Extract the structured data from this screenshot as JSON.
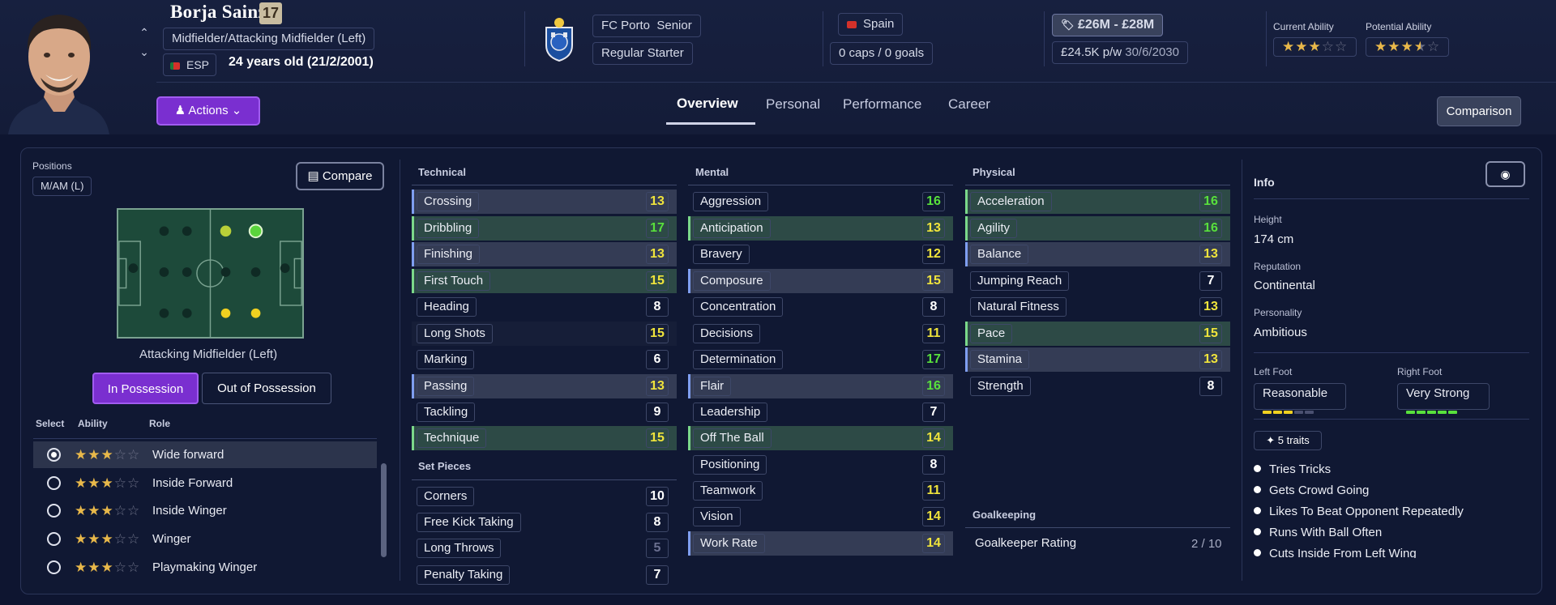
{
  "player": {
    "name": "Borja Sainz",
    "number": "17",
    "position": "Midfielder/Attacking Midfielder (Left)",
    "nationality_code": "ESP",
    "age_line": "24 years old (21/2/2001)"
  },
  "club": {
    "name": "FC Porto",
    "squad": "Senior",
    "status": "Regular Starter"
  },
  "nation": {
    "country": "Spain",
    "caps": "0 caps / 0 goals"
  },
  "contract": {
    "value": "£26M - £28M",
    "wage": "£24.5K p/w",
    "expiry": "30/6/2030"
  },
  "ability": {
    "current_label": "Current Ability",
    "potential_label": "Potential Ability",
    "current_stars": 3,
    "potential_stars": 3.5
  },
  "actions_label": "Actions",
  "tabs": [
    "Overview",
    "Personal",
    "Performance",
    "Career"
  ],
  "comparison_label": "Comparison",
  "positions": {
    "label": "Positions",
    "short": "M/AM (L)",
    "compare_label": "Compare",
    "current_position": "Attacking Midfielder (Left)",
    "in_possession": "In Possession",
    "out_of_possession": "Out of Possession",
    "col_select": "Select",
    "col_ability": "Ability",
    "col_role": "Role",
    "roles": [
      {
        "name": "Wide forward",
        "stars": 3,
        "selected": true
      },
      {
        "name": "Inside Forward",
        "stars": 3,
        "selected": false
      },
      {
        "name": "Inside Winger",
        "stars": 3,
        "selected": false
      },
      {
        "name": "Winger",
        "stars": 3,
        "selected": false
      },
      {
        "name": "Playmaking Winger",
        "stars": 3,
        "selected": false
      }
    ]
  },
  "technical": {
    "title": "Technical",
    "attrs": [
      {
        "name": "Crossing",
        "value": "13"
      },
      {
        "name": "Dribbling",
        "value": "17"
      },
      {
        "name": "Finishing",
        "value": "13"
      },
      {
        "name": "First Touch",
        "value": "15"
      },
      {
        "name": "Heading",
        "value": "8"
      },
      {
        "name": "Long Shots",
        "value": "15"
      },
      {
        "name": "Marking",
        "value": "6"
      },
      {
        "name": "Passing",
        "value": "13"
      },
      {
        "name": "Tackling",
        "value": "9"
      },
      {
        "name": "Technique",
        "value": "15"
      }
    ]
  },
  "set_pieces": {
    "title": "Set Pieces",
    "attrs": [
      {
        "name": "Corners",
        "value": "10"
      },
      {
        "name": "Free Kick Taking",
        "value": "8"
      },
      {
        "name": "Long Throws",
        "value": "5"
      },
      {
        "name": "Penalty Taking",
        "value": "7"
      }
    ]
  },
  "mental": {
    "title": "Mental",
    "attrs": [
      {
        "name": "Aggression",
        "value": "16"
      },
      {
        "name": "Anticipation",
        "value": "13"
      },
      {
        "name": "Bravery",
        "value": "12"
      },
      {
        "name": "Composure",
        "value": "15"
      },
      {
        "name": "Concentration",
        "value": "8"
      },
      {
        "name": "Decisions",
        "value": "11"
      },
      {
        "name": "Determination",
        "value": "17"
      },
      {
        "name": "Flair",
        "value": "16"
      },
      {
        "name": "Leadership",
        "value": "7"
      },
      {
        "name": "Off The Ball",
        "value": "14"
      },
      {
        "name": "Positioning",
        "value": "8"
      },
      {
        "name": "Teamwork",
        "value": "11"
      },
      {
        "name": "Vision",
        "value": "14"
      },
      {
        "name": "Work Rate",
        "value": "14"
      }
    ]
  },
  "physical": {
    "title": "Physical",
    "attrs": [
      {
        "name": "Acceleration",
        "value": "16"
      },
      {
        "name": "Agility",
        "value": "16"
      },
      {
        "name": "Balance",
        "value": "13"
      },
      {
        "name": "Jumping Reach",
        "value": "7"
      },
      {
        "name": "Natural Fitness",
        "value": "13"
      },
      {
        "name": "Pace",
        "value": "15"
      },
      {
        "name": "Stamina",
        "value": "13"
      },
      {
        "name": "Strength",
        "value": "8"
      }
    ]
  },
  "goalkeeping": {
    "title": "Goalkeeping",
    "rating_label": "Goalkeeper Rating",
    "rating_value": "2 / 10"
  },
  "info": {
    "title": "Info",
    "height_label": "Height",
    "height": "174 cm",
    "reputation_label": "Reputation",
    "reputation": "Continental",
    "personality_label": "Personality",
    "personality": "Ambitious",
    "left_foot_label": "Left Foot",
    "left_foot": "Reasonable",
    "right_foot_label": "Right Foot",
    "right_foot": "Very Strong",
    "traits_count": "5 traits",
    "traits": [
      "Tries Tricks",
      "Gets Crowd Going",
      "Likes To Beat Opponent Repeatedly",
      "Runs With Ball Often",
      "Cuts Inside From Left Wing"
    ]
  },
  "colors": {
    "accent": "#7a2fd0",
    "value_green": "#58e03c",
    "value_yellow": "#f0e43c",
    "star": "#e8b84a"
  }
}
